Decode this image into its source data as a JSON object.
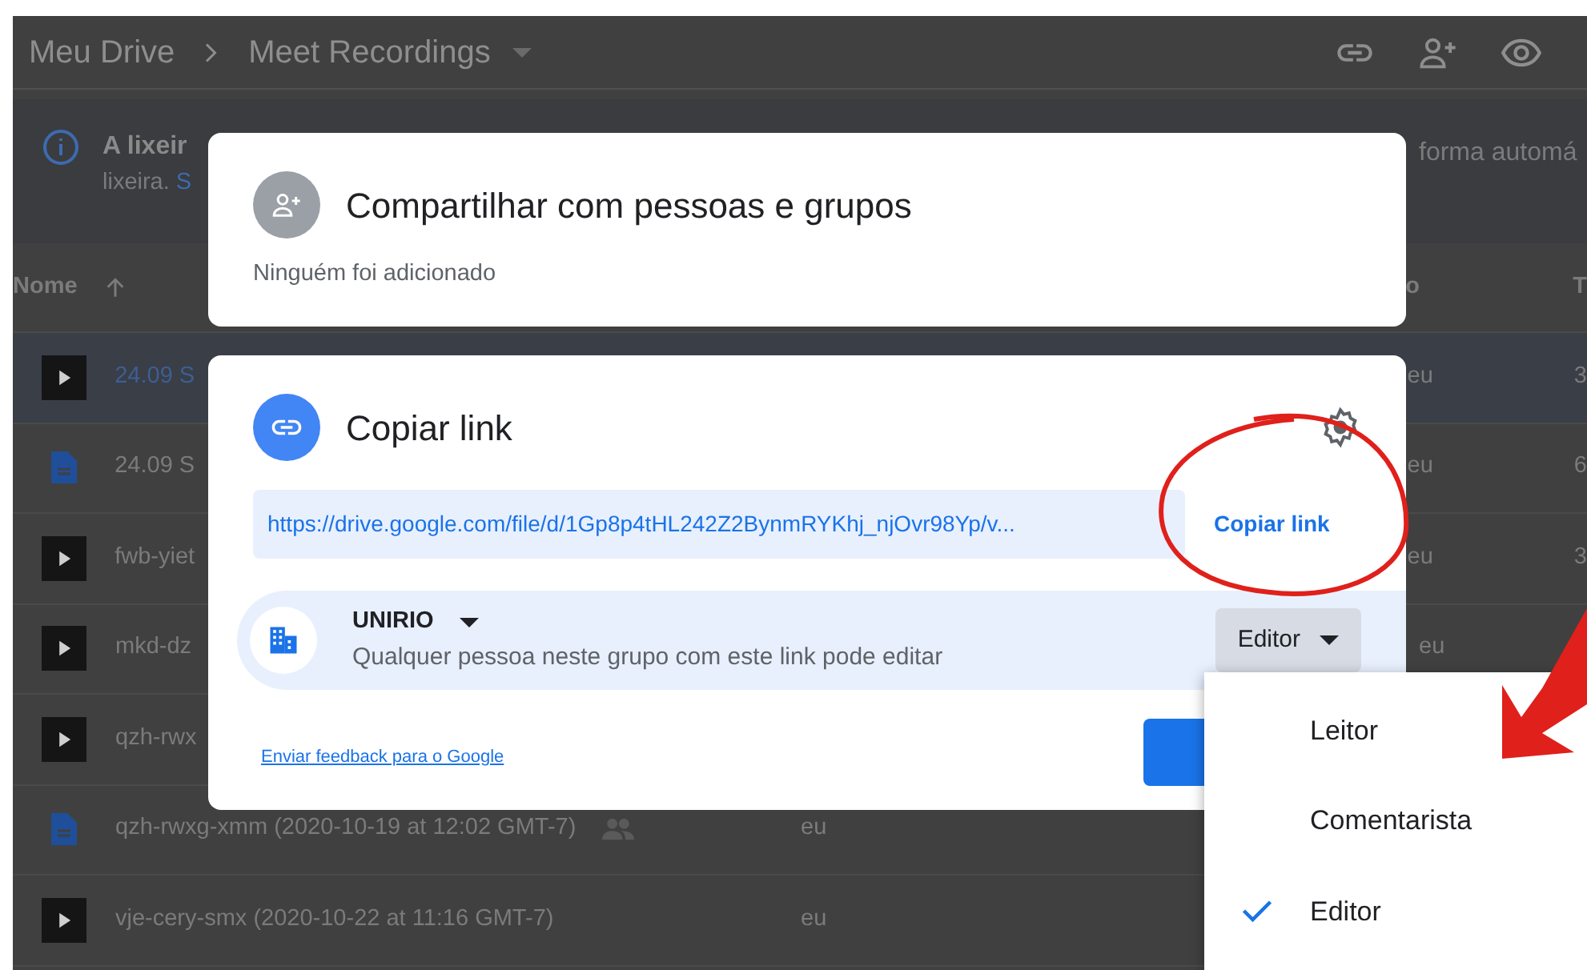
{
  "header": {
    "breadcrumb": [
      "Meu Drive",
      "Meet Recordings"
    ]
  },
  "banner": {
    "title": "A lixeir",
    "line2": "lixeira.",
    "link": "S",
    "right_text": "forma automá"
  },
  "columns": [
    {
      "label": "Nome",
      "sorted": true
    },
    {
      "label": "o",
      "sorted": false
    },
    {
      "label": "T",
      "sorted": false
    }
  ],
  "rows": [
    {
      "kind": "video",
      "name": "24.09 S",
      "owner": "eu",
      "column_4": "3",
      "shared": false,
      "selected": true
    },
    {
      "kind": "doc",
      "name": "24.09 S",
      "owner": "eu",
      "column_4": "6",
      "shared": false,
      "selected": false
    },
    {
      "kind": "video",
      "name": "fwb-yiet",
      "owner": "eu",
      "column_4": "3",
      "shared": false,
      "selected": false
    },
    {
      "kind": "video",
      "name": "mkd-dz",
      "owner": "eu",
      "shared": false,
      "selected": false
    },
    {
      "kind": "video",
      "name": "qzh-rwx",
      "shared": false,
      "selected": false
    },
    {
      "kind": "doc",
      "name": "qzh-rwxg-xmm (2020-10-19 at 12:02 GMT-7)",
      "column_2": "eu",
      "shared": true,
      "selected": false
    },
    {
      "kind": "video",
      "name": "vje-cery-smx (2020-10-22 at 11:16 GMT-7)",
      "column_2": "eu",
      "shared": false,
      "selected": false
    }
  ],
  "share_dialog": {
    "title": "Compartilhar com pessoas e grupos",
    "subtitle": "Ninguém foi adicionado"
  },
  "link_dialog": {
    "title": "Copiar link",
    "url": "https://drive.google.com/file/d/1Gp8p4tHL242Z2BynmRYKhj_njOvr98Yp/v...",
    "copy_button": "Copiar link",
    "group": "UNIRIO",
    "description": "Qualquer pessoa neste grupo com este link pode editar",
    "role": "Editor",
    "feedback": "Enviar feedback para o Google"
  },
  "role_menu": [
    {
      "label": "Leitor",
      "selected": false
    },
    {
      "label": "Comentarista",
      "selected": false
    },
    {
      "label": "Editor",
      "selected": true
    }
  ]
}
